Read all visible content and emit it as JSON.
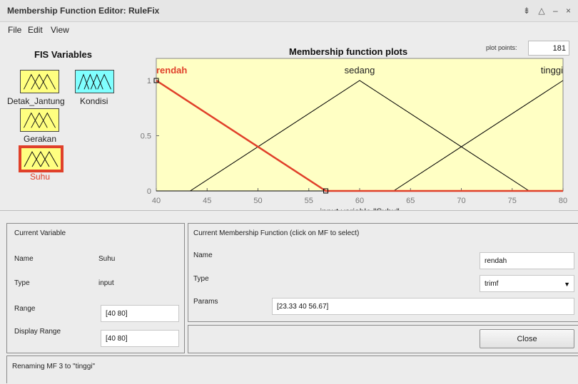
{
  "window": {
    "title": "Membership Function Editor: RuleFix",
    "controls": "⇟ △ – ×"
  },
  "menu": {
    "file": "File",
    "edit": "Edit",
    "view": "View"
  },
  "fis": {
    "title": "FIS Variables",
    "variables": [
      {
        "name": "Detak_Jantung",
        "kind": "input",
        "color": "#ffff80",
        "selected": false
      },
      {
        "name": "Kondisi",
        "kind": "output",
        "color": "#80ffff",
        "selected": false
      },
      {
        "name": "Gerakan",
        "kind": "input",
        "color": "#ffff80",
        "selected": false
      },
      {
        "name": "Suhu",
        "kind": "input",
        "color": "#ffff80",
        "selected": true
      }
    ]
  },
  "plot": {
    "title": "Membership function plots",
    "plot_points_label": "plot points:",
    "plot_points_value": "181"
  },
  "chart_data": {
    "type": "line",
    "xlabel": "input variable \"Suhu\"",
    "xlim": [
      40,
      80
    ],
    "ylim": [
      0,
      1
    ],
    "xticks": [
      40,
      45,
      50,
      55,
      60,
      65,
      70,
      75,
      80
    ],
    "yticks": [
      0,
      0.5,
      1
    ],
    "series": [
      {
        "name": "rendah",
        "params": [
          23.33,
          40,
          56.67
        ],
        "selected": true
      },
      {
        "name": "sedang",
        "params": [
          43.33,
          60,
          76.67
        ],
        "selected": false
      },
      {
        "name": "tinggi",
        "params": [
          63.33,
          80,
          96.67
        ],
        "selected": false
      }
    ],
    "colors": {
      "selected": "#e0402a",
      "normal": "#000000",
      "background": "#ffffc4"
    }
  },
  "current_variable": {
    "title": "Current Variable",
    "name_label": "Name",
    "name_value": "Suhu",
    "type_label": "Type",
    "type_value": "input",
    "range_label": "Range",
    "range_value": "[40 80]",
    "display_range_label": "Display Range",
    "display_range_value": "[40 80]"
  },
  "current_mf": {
    "title": "Current Membership Function (click on MF to select)",
    "name_label": "Name",
    "name_value": "rendah",
    "type_label": "Type",
    "type_value": "trimf",
    "params_label": "Params",
    "params_value": "[23.33 40 56.67]",
    "close_label": "Close"
  },
  "status": {
    "message": "Renaming MF 3 to \"tinggi\""
  }
}
